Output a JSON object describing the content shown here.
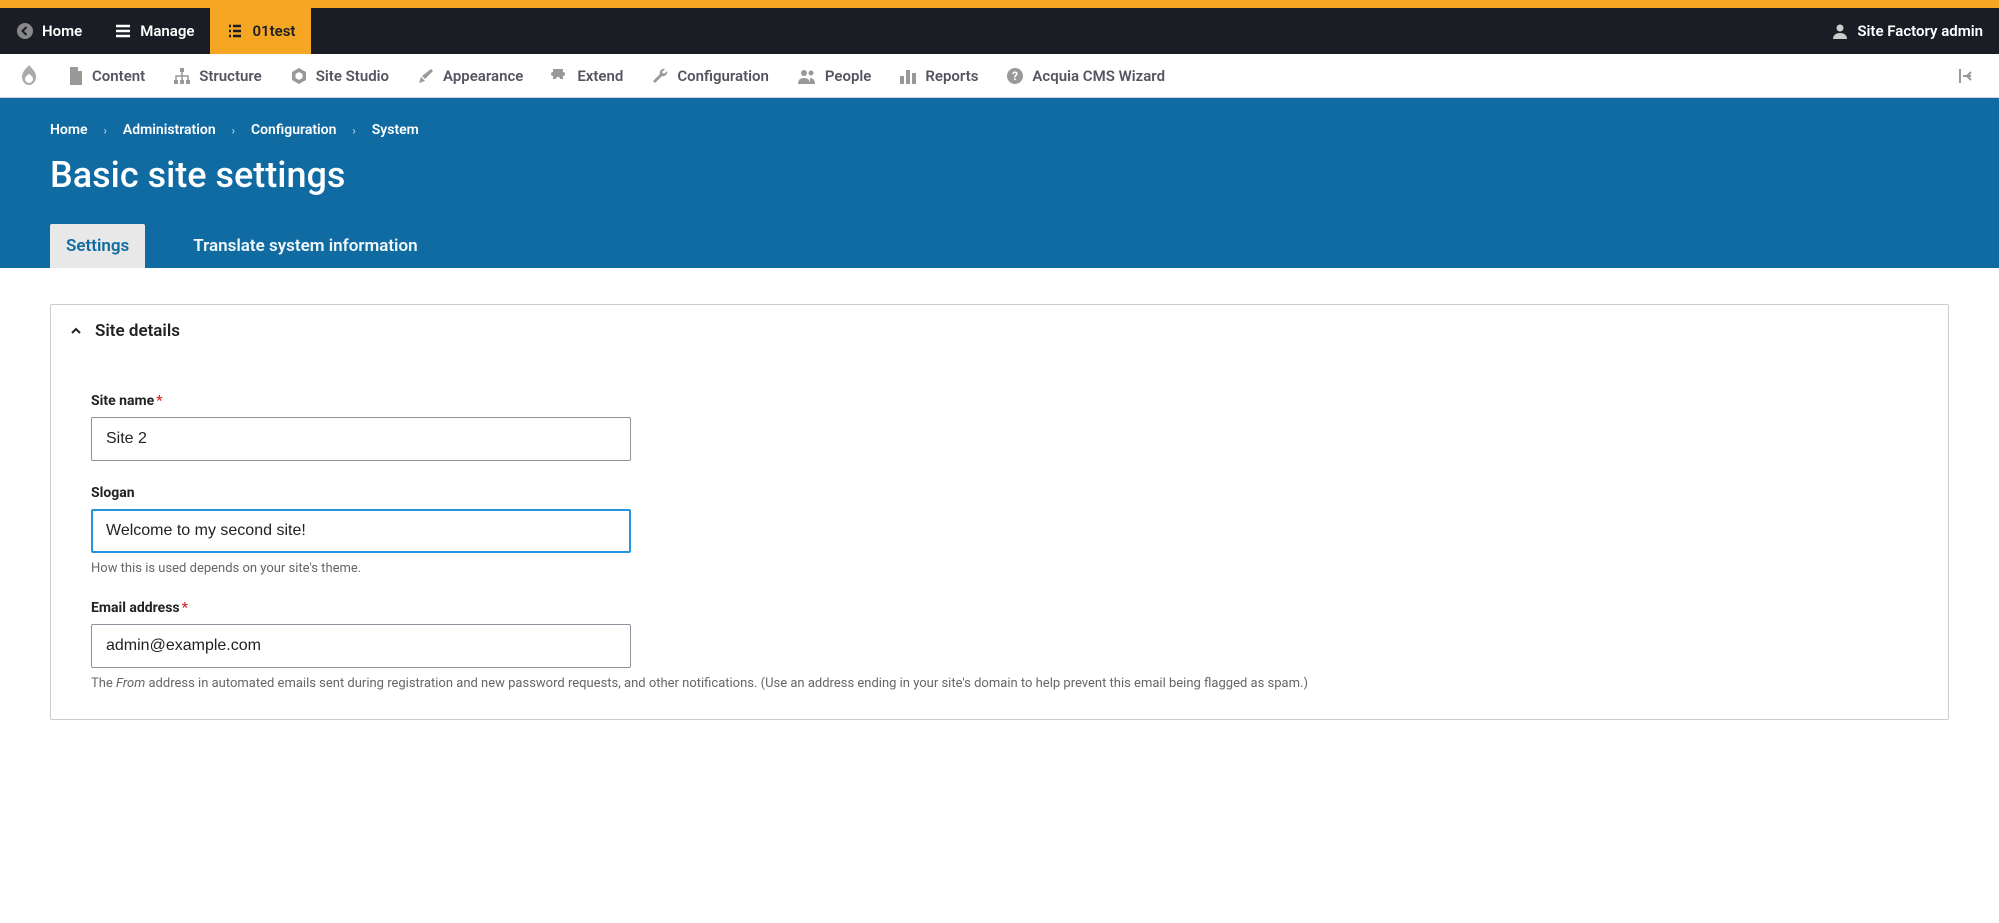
{
  "toolbar": {
    "home": "Home",
    "manage": "Manage",
    "site_name": "01test",
    "user": "Site Factory admin"
  },
  "admin_menu": {
    "items": [
      {
        "label": "Content"
      },
      {
        "label": "Structure"
      },
      {
        "label": "Site Studio"
      },
      {
        "label": "Appearance"
      },
      {
        "label": "Extend"
      },
      {
        "label": "Configuration"
      },
      {
        "label": "People"
      },
      {
        "label": "Reports"
      },
      {
        "label": "Acquia CMS Wizard"
      }
    ]
  },
  "breadcrumb": {
    "items": [
      "Home",
      "Administration",
      "Configuration",
      "System"
    ]
  },
  "page_title": "Basic site settings",
  "tabs": {
    "settings": "Settings",
    "translate": "Translate system information"
  },
  "panel": {
    "title": "Site details"
  },
  "form": {
    "site_name": {
      "label": "Site name",
      "value": "Site 2"
    },
    "slogan": {
      "label": "Slogan",
      "value": "Welcome to my second site!",
      "help": "How this is used depends on your site's theme."
    },
    "email": {
      "label": "Email address",
      "value": "admin@example.com",
      "help_prefix": "The ",
      "help_em": "From",
      "help_suffix": " address in automated emails sent during registration and new password requests, and other notifications. (Use an address ending in your site's domain to help prevent this email being flagged as spam.)"
    }
  }
}
